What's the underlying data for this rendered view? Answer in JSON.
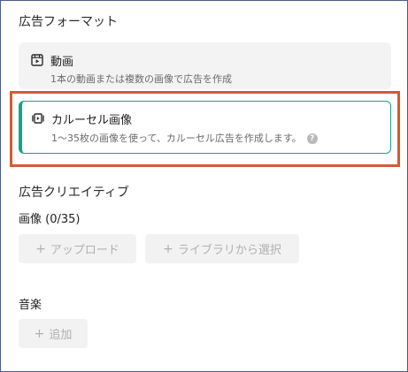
{
  "ad_format": {
    "heading": "広告フォーマット",
    "options": [
      {
        "title": "動画",
        "description": "1本の動画または複数の画像で広告を作成",
        "icon": "video-icon",
        "selected": false
      },
      {
        "title": "カルーセル画像",
        "description": "1～35枚の画像を使って、カルーセル広告を作成します。",
        "icon": "carousel-icon",
        "help_glyph": "?",
        "selected": true
      }
    ]
  },
  "ad_creative": {
    "heading": "広告クリエイティブ",
    "images_label": "画像 (0/35)",
    "upload_button": "アップロード",
    "library_button": "ライブラリから選択",
    "plus_glyph": "+"
  },
  "music": {
    "heading": "音楽",
    "add_button": "追加",
    "plus_glyph": "+"
  },
  "colors": {
    "accent": "#14a38b",
    "highlight": "#d45a33",
    "frame_border": "#4a5a8c"
  }
}
